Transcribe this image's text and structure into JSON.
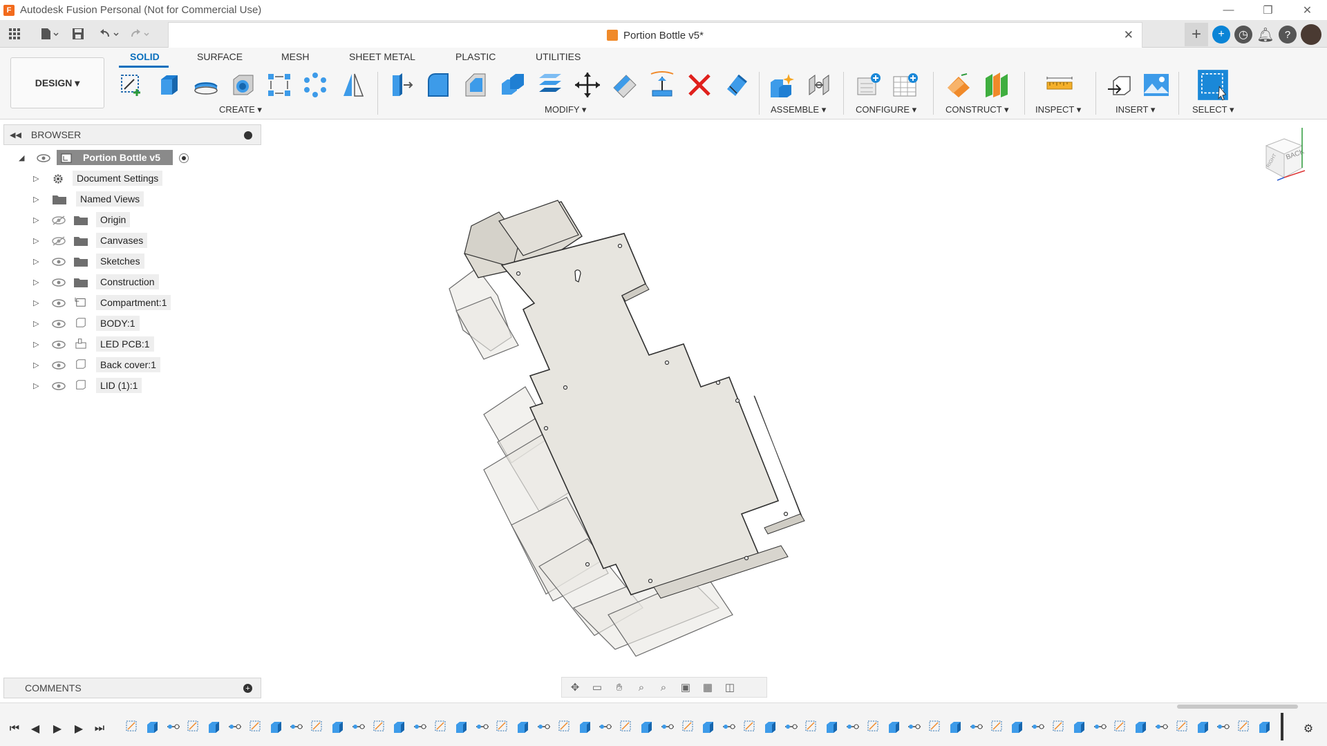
{
  "window": {
    "title": "Autodesk Fusion Personal (Not for Commercial Use)",
    "app_logo_letter": "F",
    "minimize": "—",
    "restore": "❐",
    "close": "✕"
  },
  "document_tab": {
    "title": "Portion Bottle v5*",
    "close": "✕"
  },
  "workspace": {
    "label": "DESIGN ▾"
  },
  "ribbon_tabs": [
    "SOLID",
    "SURFACE",
    "MESH",
    "SHEET METAL",
    "PLASTIC",
    "UTILITIES"
  ],
  "ribbon_groups": [
    "CREATE ▾",
    "MODIFY ▾",
    "ASSEMBLE ▾",
    "CONFIGURE ▾",
    "CONSTRUCT ▾",
    "INSPECT ▾",
    "INSERT ▾",
    "SELECT ▾"
  ],
  "browser": {
    "title": "BROWSER",
    "root": "Portion Bottle v5",
    "items": [
      {
        "label": "Document Settings"
      },
      {
        "label": "Named Views"
      },
      {
        "label": "Origin"
      },
      {
        "label": "Canvases"
      },
      {
        "label": "Sketches"
      },
      {
        "label": "Construction"
      },
      {
        "label": "Compartment:1"
      },
      {
        "label": "BODY:1"
      },
      {
        "label": "LED PCB:1"
      },
      {
        "label": "Back cover:1"
      },
      {
        "label": "LID (1):1"
      }
    ]
  },
  "comments": {
    "title": "COMMENTS",
    "plus": "+"
  },
  "viewcube": {
    "back": "BACK",
    "right": "RIGHT"
  },
  "colors": {
    "accent": "#0a6fbd",
    "model_face": "#e7e5df",
    "model_edge": "#4a4a4a"
  }
}
